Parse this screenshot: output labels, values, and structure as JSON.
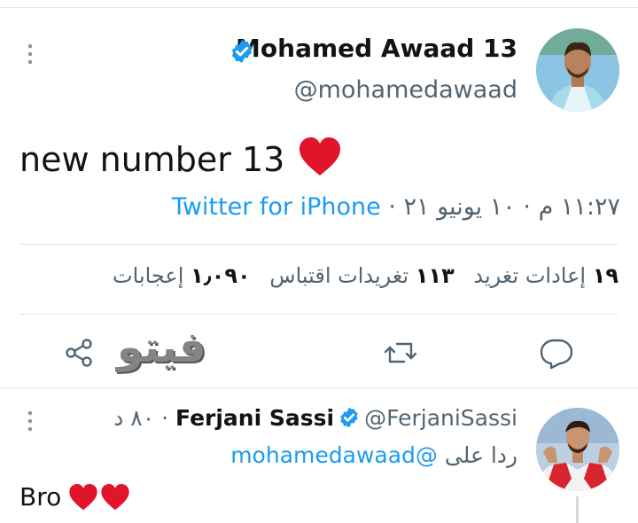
{
  "main_tweet": {
    "author_name": "Mohamed Awaad 13",
    "author_handle": "@mohamedawaad",
    "text": "new number 13",
    "time": "١١:٢٧ م",
    "date": "١٠ يونيو ٢١",
    "source": "Twitter for iPhone",
    "separator": "·"
  },
  "stats": {
    "retweets_count": "١٩",
    "retweets_label": "إعادات تغريد",
    "quotes_count": "١١٣",
    "quotes_label": "تغريدات اقتباس",
    "likes_count": "١٫٠٩٠",
    "likes_label": "إعجابات"
  },
  "watermark": "فيتو",
  "reply_tweet": {
    "author_name": "Ferjani Sassi",
    "author_handle": "@FerjaniSassi",
    "time": "٨٠ د",
    "replying_prefix": "ردا على",
    "replying_to": "@mohamedawaad",
    "text": "Bro",
    "separator": "·"
  },
  "icons": {
    "verified": "verified-badge-icon",
    "more": "more-vertical-icon",
    "heart": "red-heart-emoji-icon",
    "reply": "reply-icon",
    "retweet": "retweet-icon",
    "share": "share-icon"
  },
  "colors": {
    "accent": "#1d9bf0",
    "heart": "#e0142b",
    "secondary_text": "#536471"
  }
}
